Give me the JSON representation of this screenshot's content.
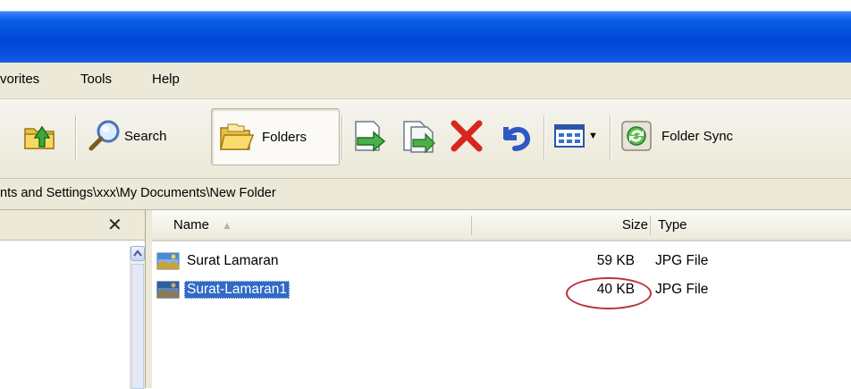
{
  "menubar": {
    "items": [
      {
        "label": "vorites"
      },
      {
        "label": "Tools"
      },
      {
        "label": "Help"
      }
    ]
  },
  "toolbar": {
    "search_label": "Search",
    "folders_label": "Folders",
    "folder_sync_label": "Folder Sync"
  },
  "address": {
    "path": "nts and Settings\\xxx\\My Documents\\New Folder"
  },
  "leftpane": {
    "close_glyph": "✕"
  },
  "listview": {
    "columns": {
      "name": "Name",
      "size": "Size",
      "type": "Type"
    },
    "rows": [
      {
        "name": "Surat Lamaran",
        "size": "59 KB",
        "type": "JPG File",
        "selected": false
      },
      {
        "name": "Surat-Lamaran1",
        "size": "40 KB",
        "type": "JPG File",
        "selected": true
      }
    ]
  },
  "colors": {
    "titlebar": "#0a4fdb",
    "selection": "#316ac5",
    "annotation_circle": "#b8323c"
  }
}
